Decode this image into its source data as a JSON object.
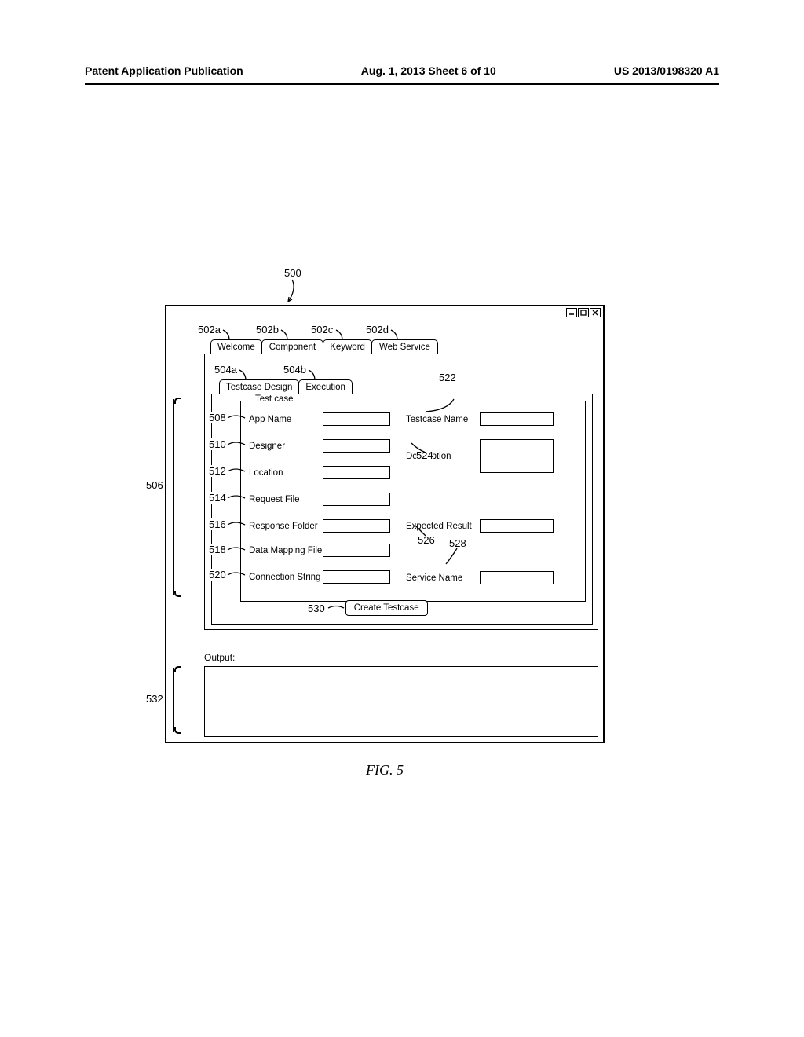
{
  "header": {
    "left": "Patent Application Publication",
    "center": "Aug. 1, 2013  Sheet 6 of 10",
    "right": "US 2013/0198320 A1"
  },
  "figure": {
    "number_500": "500",
    "caption": "FIG. 5"
  },
  "tabs_primary": {
    "welcome": "Welcome",
    "component": "Component",
    "keyword": "Keyword",
    "webservice": "Web Service"
  },
  "tabs_secondary": {
    "testcase_design": "Testcase Design",
    "execution": "Execution"
  },
  "fieldset": {
    "legend": "Test case",
    "app_name": "App Name",
    "designer": "Designer",
    "location": "Location",
    "request_file": "Request File",
    "response_folder": "Response Folder",
    "data_mapping_file": "Data Mapping File",
    "connection_string": "Connection String",
    "testcase_name": "Testcase Name",
    "description": "Description",
    "expected_result": "Expected Result",
    "service_name": "Service Name"
  },
  "buttons": {
    "create_testcase": "Create Testcase"
  },
  "output": {
    "label": "Output:"
  },
  "refs": {
    "r500": "500",
    "r502a": "502a",
    "r502b": "502b",
    "r502c": "502c",
    "r502d": "502d",
    "r504a": "504a",
    "r504b": "504b",
    "r506": "506",
    "r508": "508",
    "r510": "510",
    "r512": "512",
    "r514": "514",
    "r516": "516",
    "r518": "518",
    "r520": "520",
    "r522": "522",
    "r524": "524",
    "r526": "526",
    "r528": "528",
    "r530": "530",
    "r532": "532"
  }
}
